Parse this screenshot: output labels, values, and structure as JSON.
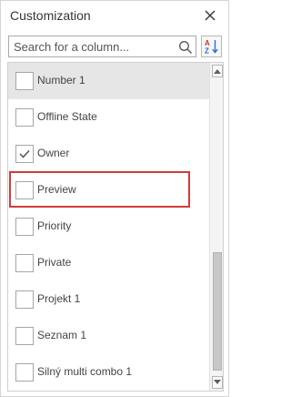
{
  "panel": {
    "title": "Customization",
    "close_icon": "close-icon"
  },
  "search": {
    "placeholder": "Search for a column...",
    "value": "",
    "icon": "search-icon"
  },
  "sort_button": {
    "icon": "sort-alpha-icon",
    "glyph_top": "A",
    "glyph_bottom": "Z",
    "accent_color": "#2b6cd6"
  },
  "columns": {
    "items": [
      {
        "label": "Number 1",
        "checked": false,
        "state": "hover"
      },
      {
        "label": "Offline State",
        "checked": false
      },
      {
        "label": "Owner",
        "checked": true
      },
      {
        "label": "Preview",
        "checked": false,
        "state": "highlighted"
      },
      {
        "label": "Priority",
        "checked": false
      },
      {
        "label": "Private",
        "checked": false
      },
      {
        "label": "Projekt 1",
        "checked": false
      },
      {
        "label": "Seznam 1",
        "checked": false
      },
      {
        "label": "Silný multi combo 1",
        "checked": false
      }
    ]
  },
  "colors": {
    "highlight_border": "#d43a3a",
    "hover_background": "#e6e6e6",
    "checkmark": "#555555"
  }
}
